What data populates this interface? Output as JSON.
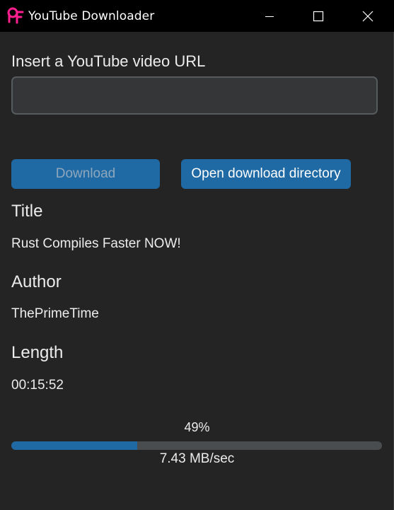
{
  "window": {
    "title": "YouTube Downloader",
    "icon": "app-logo-icon",
    "controls": [
      "minimize-icon",
      "maximize-icon",
      "close-icon"
    ]
  },
  "url_section": {
    "label": "Insert a YouTube video URL",
    "input_value": "",
    "input_placeholder": ""
  },
  "buttons": {
    "download_label": "Download",
    "download_enabled": false,
    "open_dir_label": "Open download directory"
  },
  "video_info": {
    "title_heading": "Title",
    "title_value": "Rust Compiles Faster NOW!",
    "author_heading": "Author",
    "author_value": "ThePrimeTime",
    "length_heading": "Length",
    "length_value": "00:15:52"
  },
  "progress": {
    "percent_label": "49%",
    "percent": 0.34,
    "speed_label": "7.43 MB/sec"
  },
  "colors": {
    "background": "#242424",
    "titlebar": "#000000",
    "accent": "#1f6aa5",
    "input_bg": "#343638",
    "input_border": "#565b5e",
    "logo_pink": "#ff1f8e"
  }
}
